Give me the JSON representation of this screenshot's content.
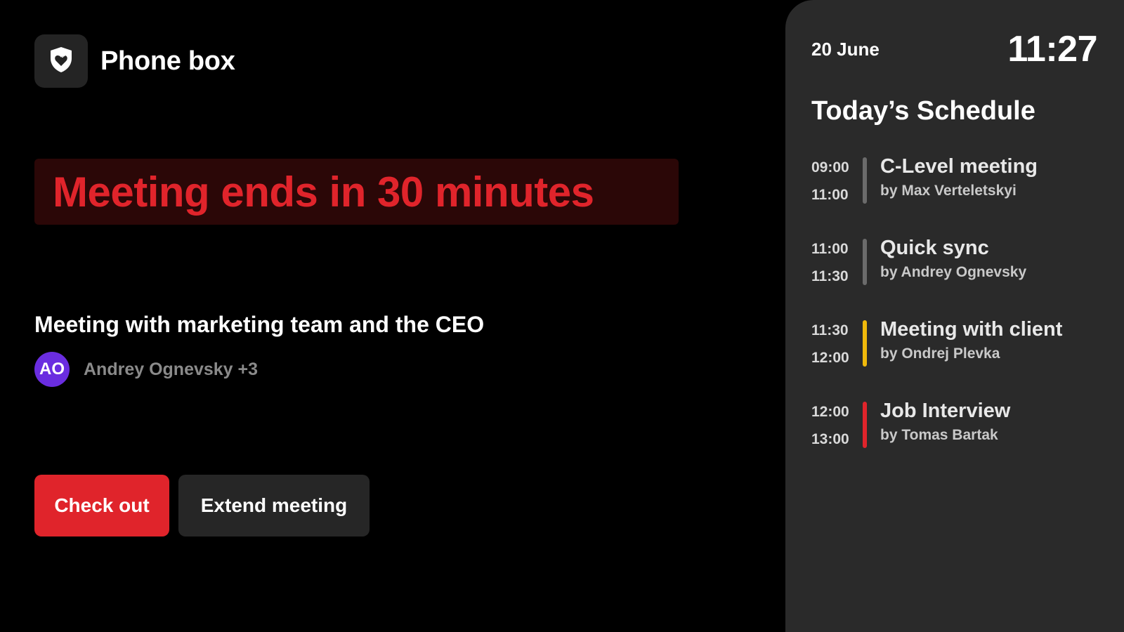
{
  "brand": {
    "name": "Phone box",
    "logo_icon": "shield-heart-icon"
  },
  "alert": {
    "text": "Meeting ends in 30 minutes",
    "color": "#e0242b",
    "background": "#2b0707"
  },
  "meeting": {
    "title": "Meeting with marketing team and the CEO",
    "organizer_initials": "AO",
    "organizer": "Andrey Ognevsky +3",
    "avatar_color": "#6a2de0"
  },
  "actions": {
    "checkout_label": "Check out",
    "extend_label": "Extend meeting"
  },
  "sidebar": {
    "date": "20 June",
    "time": "11:27",
    "schedule_title": "Today’s Schedule",
    "items": [
      {
        "start": "09:00",
        "end": "11:00",
        "title": "C-Level meeting",
        "by": "by Max Verteletskyi",
        "bar_color": "#6b6b6b"
      },
      {
        "start": "11:00",
        "end": "11:30",
        "title": "Quick sync",
        "by": "by Andrey Ognevsky",
        "bar_color": "#6b6b6b"
      },
      {
        "start": "11:30",
        "end": "12:00",
        "title": "Meeting with client",
        "by": "by Ondrej Plevka",
        "bar_color": "#f0b90b"
      },
      {
        "start": "12:00",
        "end": "13:00",
        "title": "Job Interview",
        "by": "by Tomas Bartak",
        "bar_color": "#e0242b"
      }
    ]
  }
}
